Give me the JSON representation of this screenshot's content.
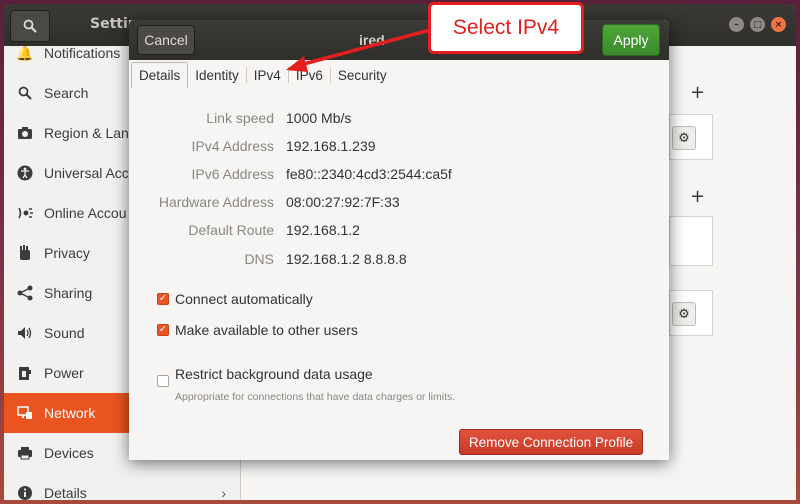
{
  "settings": {
    "title": "Settin",
    "sidebar": [
      {
        "label": "Notifications",
        "icon": "bell-icon"
      },
      {
        "label": "Search",
        "icon": "search-icon"
      },
      {
        "label": "Region & Lang",
        "icon": "camera-icon"
      },
      {
        "label": "Universal Acce",
        "icon": "accessibility-icon"
      },
      {
        "label": "Online Accou",
        "icon": "online-accounts-icon"
      },
      {
        "label": "Privacy",
        "icon": "hand-icon"
      },
      {
        "label": "Sharing",
        "icon": "share-icon"
      },
      {
        "label": "Sound",
        "icon": "speaker-icon"
      },
      {
        "label": "Power",
        "icon": "power-plug-icon"
      },
      {
        "label": "Network",
        "icon": "network-icon",
        "active": true
      },
      {
        "label": "Devices",
        "icon": "printer-icon"
      },
      {
        "label": "Details",
        "icon": "info-icon"
      }
    ]
  },
  "dialog": {
    "cancel_label": "Cancel",
    "title": "ired",
    "apply_label": "Apply",
    "tabs": [
      "Details",
      "Identity",
      "IPv4",
      "IPv6",
      "Security"
    ],
    "details": [
      {
        "label": "Link speed",
        "value": "1000 Mb/s"
      },
      {
        "label": "IPv4 Address",
        "value": "192.168.1.239"
      },
      {
        "label": "IPv6 Address",
        "value": "fe80::2340:4cd3:2544:ca5f"
      },
      {
        "label": "Hardware Address",
        "value": "08:00:27:92:7F:33"
      },
      {
        "label": "Default Route",
        "value": "192.168.1.2"
      },
      {
        "label": "DNS",
        "value": "192.168.1.2 8.8.8.8"
      }
    ],
    "options": [
      {
        "label": "Connect automatically",
        "checked": true
      },
      {
        "label": "Make available to other users",
        "checked": true
      },
      {
        "label": "Restrict background data usage",
        "checked": false,
        "note": "Appropriate for connections that have data charges or limits."
      }
    ],
    "remove_label": "Remove Connection Profile"
  },
  "callout": {
    "text": "Select IPv4",
    "color": "#e31f1f"
  },
  "colors": {
    "accent": "#e95420",
    "apply": "#3f9a2e",
    "remove": "#d6452f"
  }
}
